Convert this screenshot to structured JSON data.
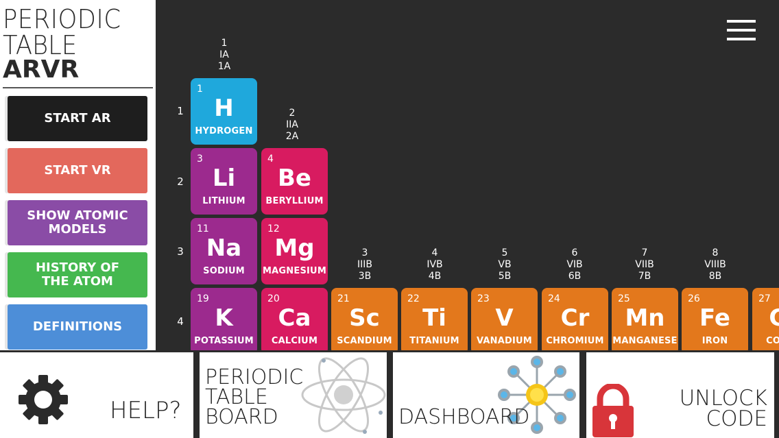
{
  "logo": {
    "line1": "PERIODIC",
    "line2": "TABLE",
    "line3": "ARVR"
  },
  "menu": {
    "start_ar": "START AR",
    "start_vr": "START VR",
    "atomic_models": [
      "SHOW ATOMIC",
      "MODELS"
    ],
    "history": [
      "HISTORY OF",
      "THE ATOM"
    ],
    "definitions": "DEFINITIONS"
  },
  "groups": [
    {
      "n": "1",
      "roman": "IA",
      "ab": "1A"
    },
    {
      "n": "2",
      "roman": "IIA",
      "ab": "2A"
    },
    {
      "n": "3",
      "roman": "IIIB",
      "ab": "3B"
    },
    {
      "n": "4",
      "roman": "IVB",
      "ab": "4B"
    },
    {
      "n": "5",
      "roman": "VB",
      "ab": "5B"
    },
    {
      "n": "6",
      "roman": "VIB",
      "ab": "6B"
    },
    {
      "n": "7",
      "roman": "VIIB",
      "ab": "7B"
    },
    {
      "n": "8",
      "roman": "VIIIB",
      "ab": "8B"
    }
  ],
  "periods": [
    "1",
    "2",
    "3",
    "4"
  ],
  "elements": [
    {
      "num": "1",
      "sym": "H",
      "name": "HYDROGEN",
      "color": "#1fa8dc"
    },
    {
      "num": "3",
      "sym": "Li",
      "name": "LITHIUM",
      "color": "#9c2a8e"
    },
    {
      "num": "4",
      "sym": "Be",
      "name": "BERYLLIUM",
      "color": "#d81b60"
    },
    {
      "num": "11",
      "sym": "Na",
      "name": "SODIUM",
      "color": "#9c2a8e"
    },
    {
      "num": "12",
      "sym": "Mg",
      "name": "MAGNESIUM",
      "color": "#d81b60"
    },
    {
      "num": "19",
      "sym": "K",
      "name": "POTASSIUM",
      "color": "#9c2a8e"
    },
    {
      "num": "20",
      "sym": "Ca",
      "name": "CALCIUM",
      "color": "#d81b60"
    },
    {
      "num": "21",
      "sym": "Sc",
      "name": "SCANDIUM",
      "color": "#e3781c"
    },
    {
      "num": "22",
      "sym": "Ti",
      "name": "TITANIUM",
      "color": "#e3781c"
    },
    {
      "num": "23",
      "sym": "V",
      "name": "VANADIUM",
      "color": "#e3781c"
    },
    {
      "num": "24",
      "sym": "Cr",
      "name": "CHROMIUM",
      "color": "#e3781c"
    },
    {
      "num": "25",
      "sym": "Mn",
      "name": "MANGANESE",
      "color": "#e3781c"
    },
    {
      "num": "26",
      "sym": "Fe",
      "name": "IRON",
      "color": "#e3781c"
    },
    {
      "num": "27",
      "sym": "Co",
      "name": "COBALT",
      "color": "#e3781c"
    }
  ],
  "bottom": {
    "help": "HELP?",
    "ptb": [
      "PERIODIC",
      "TABLE",
      "BOARD"
    ],
    "dashboard": "DASHBOARD",
    "unlock": [
      "UNLOCK",
      "CODE"
    ]
  },
  "icons": {
    "settings": "gear-icon",
    "menu": "hamburger-menu-icon",
    "atom": "atom-icon",
    "network": "network-hub-icon",
    "lock": "padlock-icon"
  }
}
